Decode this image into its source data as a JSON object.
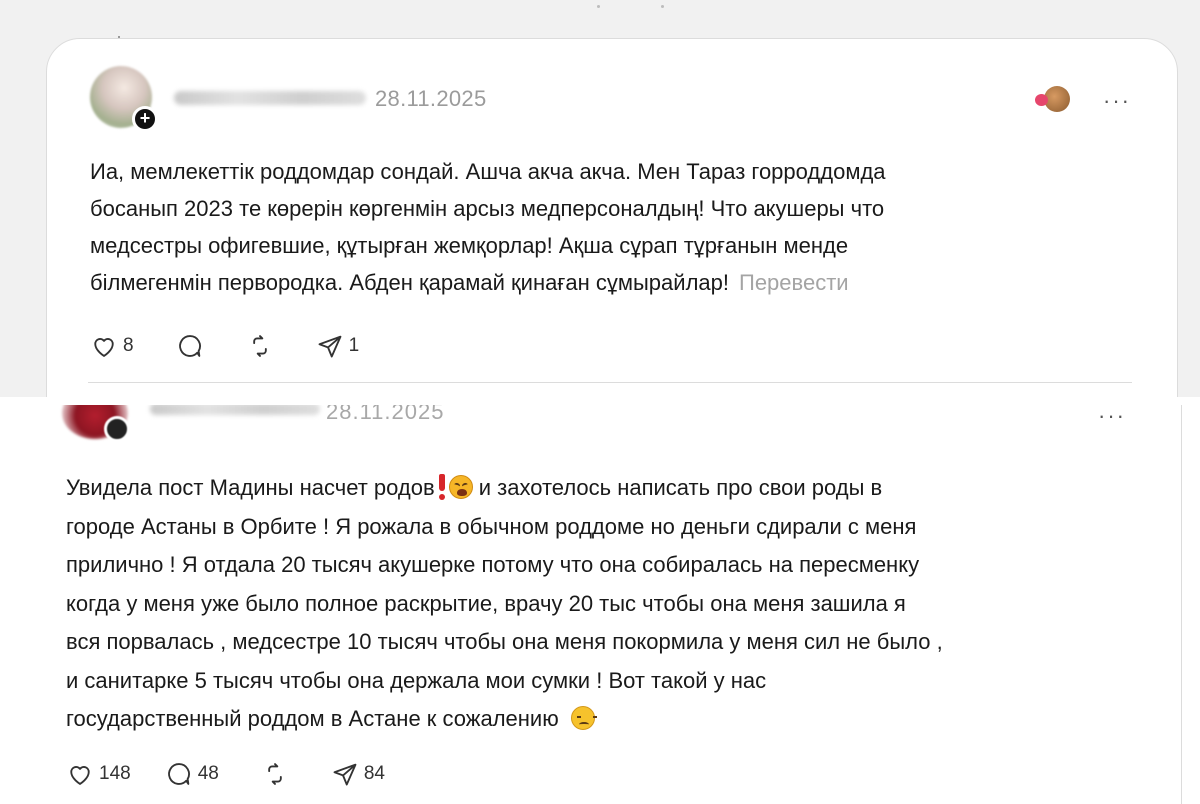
{
  "post1": {
    "date": "28.11.2025",
    "more_label": "···",
    "text_lines": [
      "Иа, мемлекеттік роддомдар сондай. Ашча акча акча. Мен Тараз горроддомда",
      "босанып 2023 те көрерін көргенмін арсыз медперсоналдың! Что акушеры что",
      "медсестры офигевшие, құтырған жемқорлар! Ақша сұрап тұрғанын менде",
      "білмегенмін первородка. Абден қарамай қинаған сұмырайлар!"
    ],
    "translate_label": "Перевести",
    "likes": "8",
    "replies": "",
    "reposts": "",
    "shares": "1"
  },
  "post2": {
    "date": "28.11.2025",
    "more_label": "···",
    "line1_a": "Увидела пост Мадины насчет родов",
    "line1_b": " и захотелось написать про свои роды в",
    "text_lines": [
      "городе Астаны в Орбите ! Я рожала в обычном роддоме но деньги сдирали с меня",
      "прилично ! Я отдала 20 тысяч акушерке потому что она собиралась на пересменку",
      "когда у меня уже было полное раскрытие, врачу 20 тыс чтобы она меня зашила я",
      "вся порвалась , медсестре 10 тысяч чтобы она меня покормила у меня сил не было ,",
      "и санитарке 5 тысяч чтобы она держала мои сумки ! Вот такой у нас"
    ],
    "last_line": "государственный роддом в Астане к сожалению",
    "likes": "148",
    "replies": "48",
    "reposts": "",
    "shares": "84"
  },
  "icons": {
    "like": "heart-icon",
    "reply": "comment-bubble-icon",
    "repost": "repost-arrows-icon",
    "share": "send-paper-plane-icon",
    "follow": "plus-icon",
    "more": "more-dots-icon",
    "emoji_weary": "weary-face-emoji",
    "emoji_exclaim": "red-exclamation-emoji",
    "emoji_disappointed": "disappointed-face-emoji"
  },
  "colors": {
    "text": "#1a1a1a",
    "muted": "#9b9b9b",
    "border": "#dcdcdc",
    "background_top": "#f1f1f1"
  }
}
